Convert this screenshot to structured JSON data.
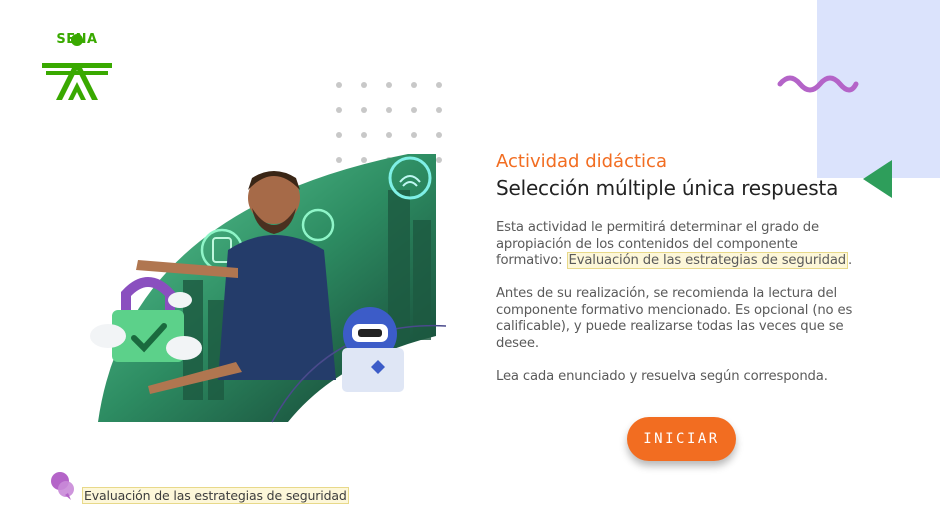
{
  "logo": {
    "text": "SENA",
    "color": "#39a900"
  },
  "activity": {
    "subtitle": "Actividad didáctica",
    "title": "Selección múltiple única respuesta",
    "paragraph1_before": "Esta actividad le permitirá determinar el grado de apropiación de los contenidos del componente formativo: ",
    "component_name": "Evaluación de las estrategias de seguridad",
    "paragraph1_after": ".",
    "paragraph2": "Antes de su realización, se recomienda la lectura del componente formativo mencionado.  Es opcional (no es calificable), y puede realizarse todas las veces que se desee.",
    "paragraph3": "Lea cada enunciado y resuelva según corresponda."
  },
  "start_button": {
    "label": "INICIAR"
  },
  "footer": {
    "label": "Evaluación de las estrategias de seguridad"
  },
  "icons": {
    "logo": "sena-logo",
    "squiggle": "wave-decoration",
    "triangle": "triangle-decoration",
    "hero": "person-with-security-icons-illustration",
    "footer": "component-icon"
  },
  "colors": {
    "accent": "#f26d21",
    "brand_green": "#39a900",
    "purple": "#b464c8",
    "panel_blue": "#dbe3fc",
    "triangle_green": "#2e9e5b"
  }
}
